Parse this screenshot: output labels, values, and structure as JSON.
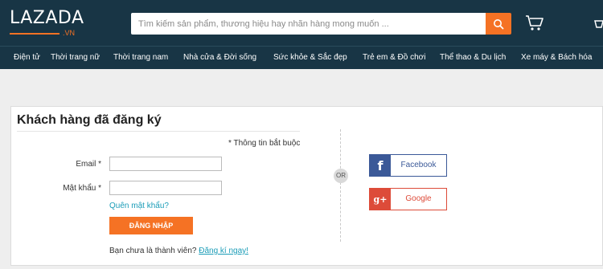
{
  "header": {
    "logo_text": "LAZADA",
    "logo_suffix": ".VN",
    "search_placeholder": "Tìm kiếm sản phẩm, thương hiệu hay nhãn hàng mong muốn ...",
    "search_icon": "search-icon",
    "cart_icon": "cart-icon"
  },
  "nav": {
    "items": [
      "Điện tử",
      "Thời trang nữ",
      "Thời trang nam",
      "Nhà cửa & Đời sống",
      "Sức khỏe & Sắc đẹp",
      "Trẻ em & Đồ chơi",
      "Thể thao & Du lịch",
      "Xe máy & Bách hóa"
    ]
  },
  "login": {
    "title": "Khách hàng đã đăng ký",
    "required_note": "* Thông tin bắt buộc",
    "email_label": "Email *",
    "email_value": "",
    "password_label": "Mật khẩu *",
    "password_value": "",
    "forgot_link": "Quên mật khẩu?",
    "login_button": "ĐĂNG NHẬP",
    "not_member_text": "Bạn chưa là thành viên?",
    "register_link": "Đăng kí ngay!"
  },
  "social": {
    "or_label": "OR",
    "facebook_icon_glyph": "f",
    "facebook_label": "Facebook",
    "google_icon_glyph": "g+",
    "google_label": "Google"
  },
  "colors": {
    "header_bg": "#183545",
    "accent": "#f57224",
    "link": "#1a9cb7",
    "facebook": "#3b5998",
    "google": "#dd4b39"
  }
}
